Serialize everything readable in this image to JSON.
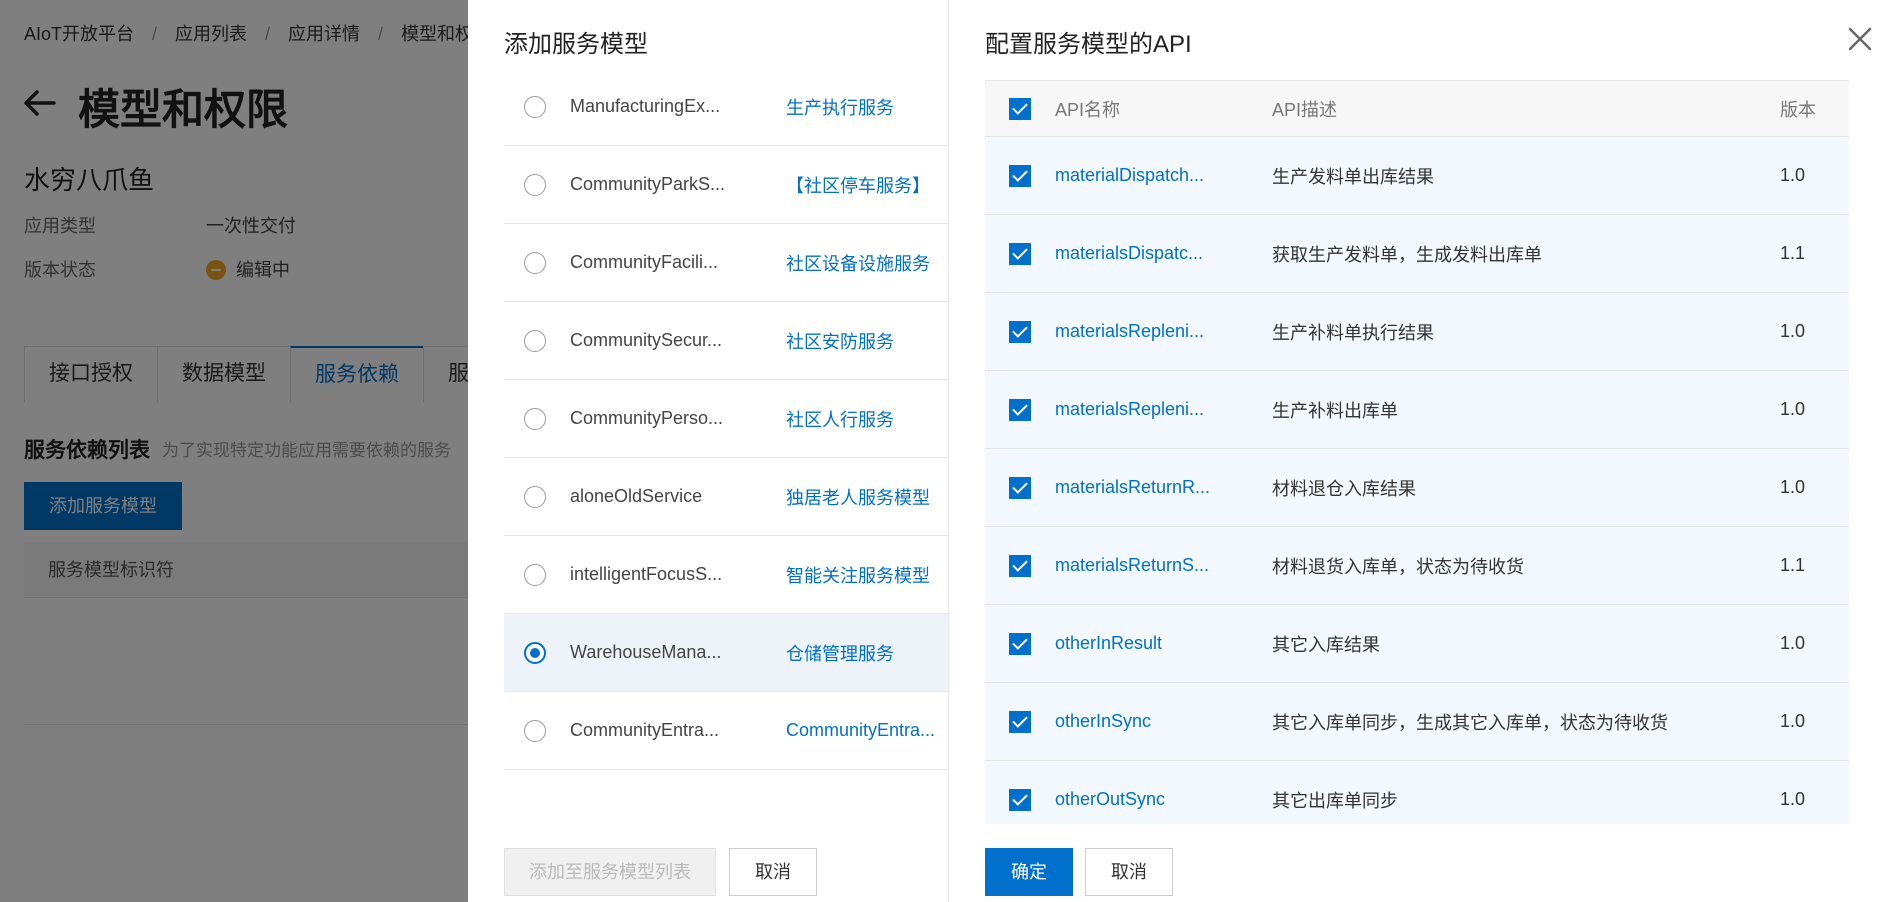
{
  "background": {
    "breadcrumb": [
      "AIoT开放平台",
      "应用列表",
      "应用详情",
      "模型和权"
    ],
    "page_title": "模型和权限",
    "app_name": "水穷八爪鱼",
    "meta": {
      "type_label": "应用类型",
      "type_value": "一次性交付",
      "status_label": "版本状态",
      "status_value": "编辑中"
    },
    "tabs": [
      "接口授权",
      "数据模型",
      "服务依赖",
      "服"
    ],
    "active_tab": 2,
    "section_title": "服务依赖列表",
    "section_desc": "为了实现特定功能应用需要依赖的服务",
    "add_button": "添加服务模型",
    "table_header": "服务模型标识符"
  },
  "add_drawer": {
    "title": "添加服务模型",
    "rows": [
      {
        "id": "ManufacturingEx...",
        "name": "生产执行服务",
        "selected": false
      },
      {
        "id": "CommunityParkS...",
        "name": "【社区停车服务】",
        "selected": false
      },
      {
        "id": "CommunityFacili...",
        "name": "社区设备设施服务",
        "selected": false
      },
      {
        "id": "CommunitySecur...",
        "name": "社区安防服务",
        "selected": false
      },
      {
        "id": "CommunityPerso...",
        "name": "社区人行服务",
        "selected": false
      },
      {
        "id": "aloneOldService",
        "name": "独居老人服务模型",
        "selected": false
      },
      {
        "id": "intelligentFocusS...",
        "name": "智能关注服务模型",
        "selected": false
      },
      {
        "id": "WarehouseMana...",
        "name": "仓储管理服务",
        "selected": true
      },
      {
        "id": "CommunityEntra...",
        "name": "CommunityEntra...",
        "selected": false
      }
    ],
    "add_to_list_button": "添加至服务模型列表",
    "cancel_button": "取消"
  },
  "api_drawer": {
    "title": "配置服务模型的API",
    "columns": {
      "name": "API名称",
      "desc": "API描述",
      "version": "版本"
    },
    "rows": [
      {
        "name": "materialDispatch...",
        "desc": "生产发料单出库结果",
        "version": "1.0",
        "checked": true
      },
      {
        "name": "materialsDispatc...",
        "desc": "获取生产发料单，生成发料出库单",
        "version": "1.1",
        "checked": true
      },
      {
        "name": "materialsRepleni...",
        "desc": "生产补料单执行结果",
        "version": "1.0",
        "checked": true
      },
      {
        "name": "materialsRepleni...",
        "desc": "生产补料出库单",
        "version": "1.0",
        "checked": true
      },
      {
        "name": "materialsReturnR...",
        "desc": "材料退仓入库结果",
        "version": "1.0",
        "checked": true
      },
      {
        "name": "materialsReturnS...",
        "desc": "材料退货入库单，状态为待收货",
        "version": "1.1",
        "checked": true
      },
      {
        "name": "otherInResult",
        "desc": "其它入库结果",
        "version": "1.0",
        "checked": true
      },
      {
        "name": "otherInSync",
        "desc": "其它入库单同步，生成其它入库单，状态为待收货",
        "version": "1.0",
        "checked": true
      },
      {
        "name": "otherOutSync",
        "desc": "其它出库单同步",
        "version": "1.0",
        "checked": true
      }
    ],
    "confirm_button": "确定",
    "cancel_button": "取消"
  },
  "colors": {
    "primary": "#0070cc",
    "status_warning": "#f5a623",
    "overlay": "rgba(0,0,0,0.5)"
  }
}
